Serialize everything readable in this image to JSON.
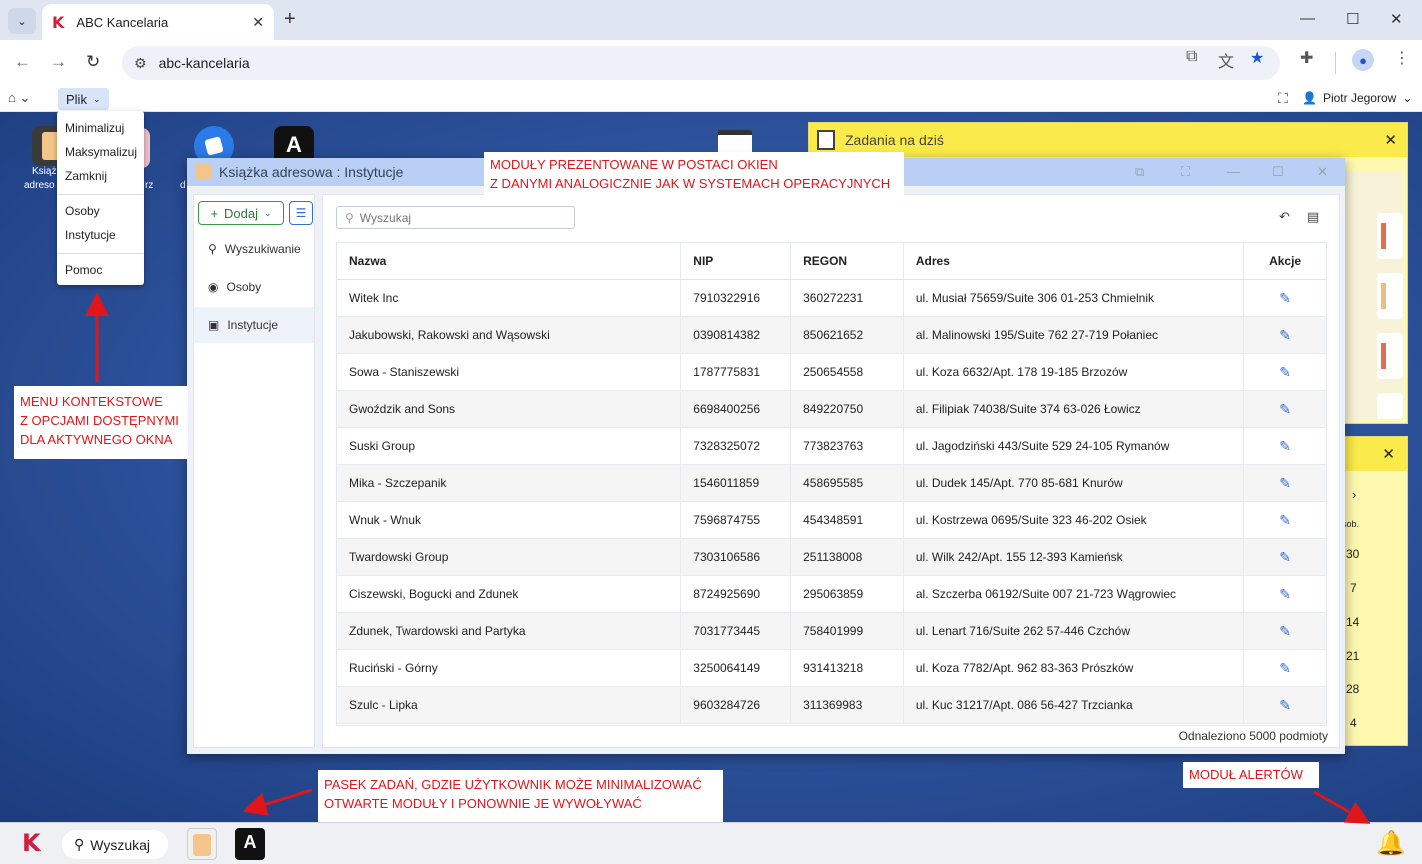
{
  "browser": {
    "tab_title": "ABC Kancelaria",
    "url": "abc-kancelaria"
  },
  "appbar": {
    "menu_label": "Plik",
    "user_name": "Piotr Jegorow"
  },
  "context_menu": {
    "items": [
      "Minimalizuj",
      "Maksymalizuj",
      "Zamknij",
      "Osoby",
      "Instytucje",
      "Pomoc"
    ]
  },
  "window": {
    "title": "Książka adresowa : Instytucje",
    "add_label": "Dodaj",
    "nav": [
      "Wyszukiwanie",
      "Osoby",
      "Instytucje"
    ],
    "search_placeholder": "Wyszukaj",
    "columns": [
      "Nazwa",
      "NIP",
      "REGON",
      "Adres",
      "Akcje"
    ],
    "rows": [
      [
        "Witek Inc",
        "7910322916",
        "360272231",
        "ul. Musiał 75659/Suite 306 01-253 Chmielnik"
      ],
      [
        "Jakubowski, Rakowski and Wąsowski",
        "0390814382",
        "850621652",
        "al. Malinowski 195/Suite 762 27-719 Połaniec"
      ],
      [
        "Sowa - Staniszewski",
        "1787775831",
        "250654558",
        "ul. Koza 6632/Apt. 178 19-185 Brzozów"
      ],
      [
        "Gwoździk and Sons",
        "6698400256",
        "849220750",
        "al. Filipiak 74038/Suite 374 63-026 Łowicz"
      ],
      [
        "Suski Group",
        "7328325072",
        "773823763",
        "ul. Jagodziński 443/Suite 529 24-105 Rymanów"
      ],
      [
        "Mika - Szczepanik",
        "1546011859",
        "458695585",
        "ul. Dudek 145/Apt. 770 85-681 Knurów"
      ],
      [
        "Wnuk - Wnuk",
        "7596874755",
        "454348591",
        "ul. Kostrzewa 0695/Suite 323 46-202 Osiek"
      ],
      [
        "Twardowski Group",
        "7303106586",
        "251138008",
        "ul. Wilk 242/Apt. 155 12-393 Kamieńsk"
      ],
      [
        "Ciszewski, Bogucki and Zdunek",
        "8724925690",
        "295063859",
        "al. Szczerba 06192/Suite 007 21-723 Wągrowiec"
      ],
      [
        "Zdunek, Twardowski and Partyka",
        "7031773445",
        "758401999",
        "ul. Lenart 716/Suite 262 57-446 Czchów"
      ],
      [
        "Ruciński - Górny",
        "3250064149",
        "931413218",
        "ul. Koza 7782/Apt. 962 83-363 Prószków"
      ],
      [
        "Szulc - Lipka",
        "9603284726",
        "311369983",
        "ul. Kuc 31217/Apt. 086 56-427 Trzcianka"
      ]
    ],
    "count_text": "Odnaleziono 5000 podmioty"
  },
  "widgets": {
    "tasks_title": "Zadania na dziś",
    "calendar_label": "sob.",
    "calendar_days": [
      "30",
      "7",
      "14",
      "21",
      "28",
      "4"
    ]
  },
  "desktop": {
    "icon_labels": [
      "Książ",
      "adreso",
      "rz",
      "d"
    ]
  },
  "annotations": {
    "windows_note": [
      "MODUŁY PREZENTOWANE W POSTACI OKIEN",
      "Z DANYMI ANALOGICZNIE JAK W SYSTEMACH OPERACYJNYCH"
    ],
    "menu_note": [
      "MENU KONTEKSTOWE",
      "Z OPCJAMI DOSTĘPNYMI",
      "DLA AKTYWNEGO OKNA"
    ],
    "taskbar_note": [
      "PASEK ZADAŃ, GDZIE UŻYTKOWNIK MOŻE MINIMALIZOWAĆ",
      "OTWARTE MODUŁY I PONOWNIE JE WYWOŁYWAĆ"
    ],
    "alerts_note": "MODUŁ ALERTÓW"
  },
  "taskbar": {
    "search_label": "Wyszukaj"
  },
  "colors": {
    "accent": "#3a6ad6",
    "add_green": "#3a9a4a",
    "annotation_red": "#e0161a",
    "tasks_yellow": "#fbeb4a",
    "desktop_blue": "#2f55a0",
    "brand_red": "#d02040"
  }
}
